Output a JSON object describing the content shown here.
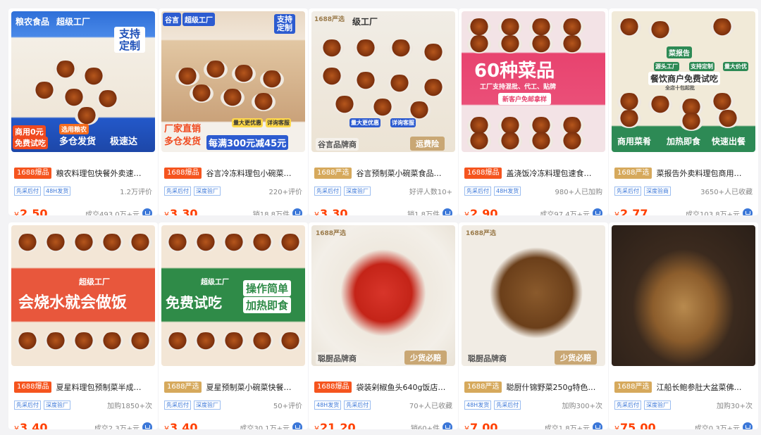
{
  "products": [
    {
      "badge": "1688爆品",
      "badge_type": "bao",
      "title": "粮农料理包快餐外卖速…",
      "tags": [
        "先采后付",
        "48H发货"
      ],
      "meta": "1.2万评价",
      "price": "2.50",
      "sales": "成交493.0万+元",
      "overlay": [
        "粮农食品",
        "超级工厂",
        "支持定制",
        "选用粮农",
        "商用0元",
        "免费试吃",
        "多仓发货",
        "极速达"
      ]
    },
    {
      "badge": "1688爆品",
      "badge_type": "bao",
      "title": "谷言冷冻料理包小碗菜…",
      "tags": [
        "先采后付",
        "深度验厂"
      ],
      "meta": "220+评价",
      "price": "3.30",
      "sales": "销18.8万件",
      "overlay": [
        "谷言",
        "超级工厂",
        "支持定制",
        "厂家直销",
        "多仓发货",
        "每满300元减45元",
        "量大更优惠",
        "详询客服"
      ]
    },
    {
      "badge": "1688严选",
      "badge_type": "yan",
      "title": "谷言预制菜小碗菜食品…",
      "tags": [
        "先采后付",
        "深度验厂"
      ],
      "meta": "好评人数10+",
      "price": "3.30",
      "sales": "销1.8万件",
      "overlay": [
        "1688严选",
        "级工厂",
        "量大更优惠",
        "详询客服",
        "谷言品牌商",
        "运费险"
      ]
    },
    {
      "badge": "1688爆品",
      "badge_type": "bao",
      "title": "盖浇饭冷冻料理包速食…",
      "tags": [
        "先采后付",
        "48H发货"
      ],
      "meta": "980+人已加购",
      "price": "2.90",
      "sales": "成交97.4万+元",
      "overlay": [
        "60种菜品",
        "工厂支持混批、代工、贴牌",
        "新客户免邮拿样"
      ]
    },
    {
      "badge": "1688严选",
      "badge_type": "yan",
      "title": "菜报告外卖料理包商用…",
      "tags": [
        "先采后付",
        "深度验商"
      ],
      "meta": "3650+人已收藏",
      "price": "2.77",
      "sales": "成交103.8万+元",
      "overlay": [
        "菜报告",
        "源头工厂",
        "支持定制",
        "量大价优",
        "餐饮商户免费试吃",
        "全店十包起批",
        "商用菜肴",
        "加热即食",
        "快速出餐"
      ]
    },
    {
      "badge": "1688爆品",
      "badge_type": "bao",
      "title": "夏星料理包预制菜半成…",
      "tags": [
        "先采后付",
        "深度验厂"
      ],
      "meta": "加购1850+次",
      "price": "3.40",
      "sales": "成交2.3万+元",
      "overlay": [
        "超级工厂",
        "会烧水就会做饭"
      ]
    },
    {
      "badge": "1688严选",
      "badge_type": "yan",
      "title": "夏星预制菜小碗菜快餐…",
      "tags": [
        "先采后付",
        "深度验厂"
      ],
      "meta": "50+评价",
      "price": "3.40",
      "sales": "成交30.1万+元",
      "overlay": [
        "超级工厂",
        "免费试吃",
        "操作简单",
        "加热即食"
      ]
    },
    {
      "badge": "1688爆品",
      "badge_type": "bao",
      "title": "袋装剁椒鱼头640g饭店…",
      "tags": [
        "48H发货",
        "先采后付"
      ],
      "meta": "70+人已收藏",
      "price": "21.20",
      "sales": "销60+件",
      "overlay": [
        "1688严选",
        "聪厨品牌商",
        "少货必赔"
      ]
    },
    {
      "badge": "1688严选",
      "badge_type": "yan",
      "title": "聪厨什锦野菜250g特色…",
      "tags": [
        "48H发货",
        "先采后付"
      ],
      "meta": "加购300+次",
      "price": "7.00",
      "sales": "成交1.8万+元",
      "overlay": [
        "1688严选",
        "聪厨品牌商",
        "少货必赔"
      ]
    },
    {
      "badge": "1688严选",
      "badge_type": "yan",
      "title": "江船长鲍参肚大盆菜佛…",
      "tags": [
        "先采后付",
        "深度验厂"
      ],
      "meta": "加购30+次",
      "price": "75.00",
      "sales": "成交0.3万+元",
      "overlay": []
    }
  ],
  "currency": "¥",
  "colors": {
    "price": "#ff4000",
    "badge_bao": "#f5541e",
    "badge_yan": "#d6a95c",
    "tag": "#3b77d8"
  }
}
